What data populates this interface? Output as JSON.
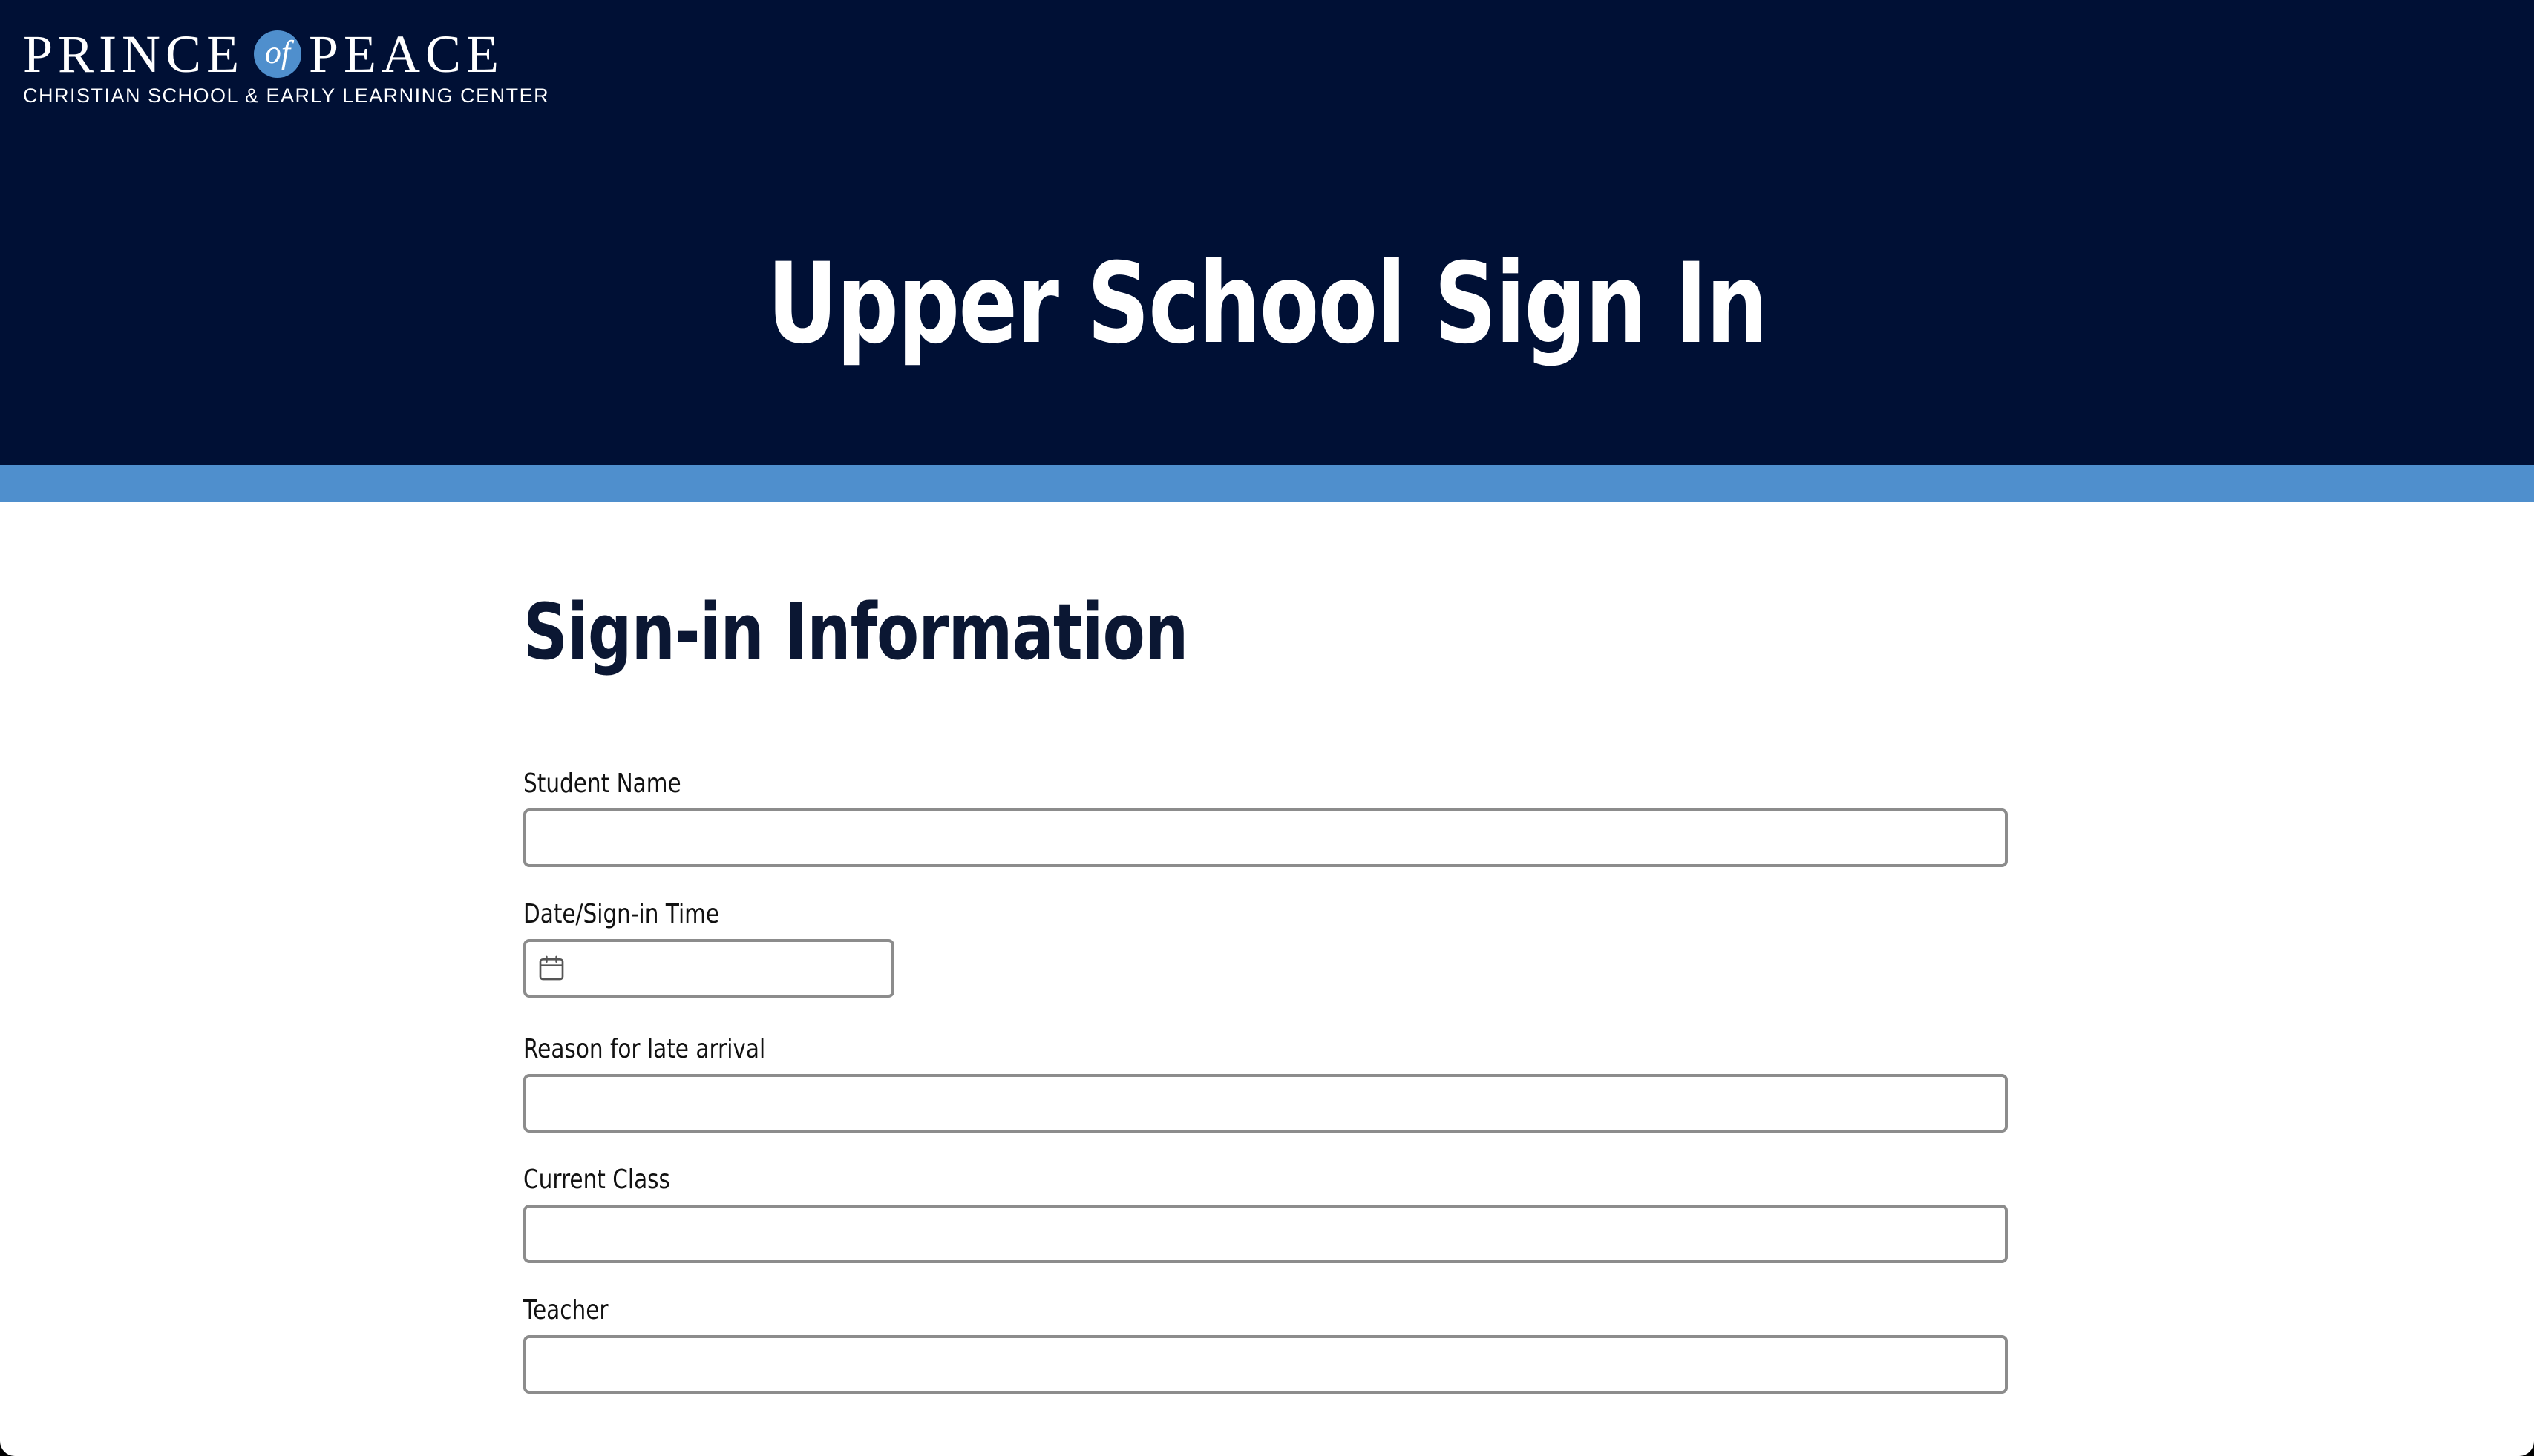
{
  "brand": {
    "name_part1": "PRINCE",
    "name_of": "of",
    "name_part2": "PEACE",
    "subtitle": "CHRISTIAN SCHOOL & EARLY LEARNING CENTER"
  },
  "page": {
    "title": "Upper School Sign In"
  },
  "form": {
    "section_title": "Sign-in Information",
    "fields": [
      {
        "label": "Student Name",
        "value": "",
        "type": "text"
      },
      {
        "label": "Date/Sign-in Time",
        "value": "",
        "type": "datetime",
        "icon": "calendar-icon"
      },
      {
        "label": "Reason for late arrival",
        "value": "",
        "type": "text"
      },
      {
        "label": "Current Class",
        "value": "",
        "type": "text"
      },
      {
        "label": "Teacher",
        "value": "",
        "type": "text"
      }
    ]
  },
  "colors": {
    "header_bg": "#001035",
    "accent": "#4f8fcd",
    "heading_text": "#0b1733",
    "input_border": "#8c8c8c"
  }
}
